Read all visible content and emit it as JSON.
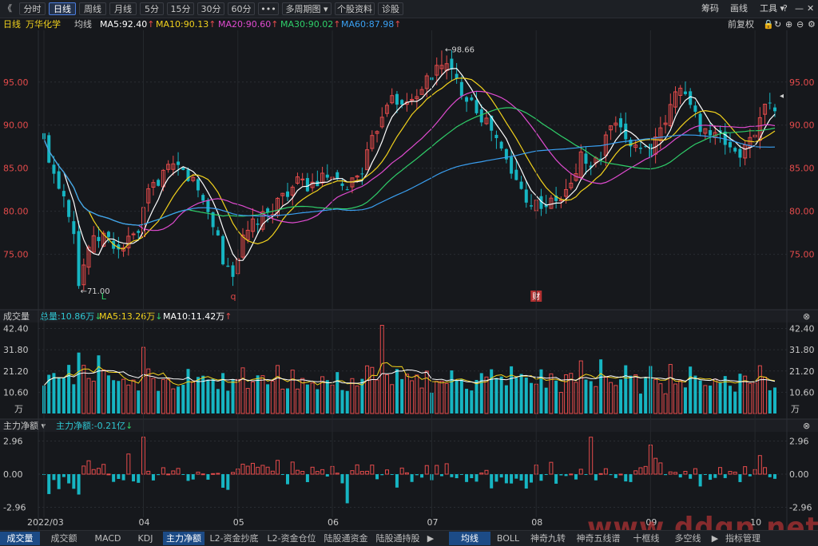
{
  "toolbar": {
    "back_glyph": "《",
    "tabs": [
      "分时",
      "日线",
      "周线",
      "月线",
      "5分",
      "15分",
      "30分",
      "60分",
      "•••",
      "多周期图 ▾",
      "个股资料",
      "诊股"
    ],
    "active_tab": "日线",
    "right": [
      "筹码",
      "画线",
      "工具 ▾"
    ],
    "icons": [
      "help-icon",
      "minimize-icon",
      "close-icon"
    ]
  },
  "header": {
    "period": "日线",
    "stock_name": "万华化学",
    "mode": "均线",
    "ma": [
      {
        "label": "MA5:92.40",
        "arrow": "↑",
        "color": "#ffffff"
      },
      {
        "label": "MA10:90.13",
        "arrow": "↑",
        "color": "#f2d21c"
      },
      {
        "label": "MA20:90.60",
        "arrow": "↑",
        "color": "#e04bd0"
      },
      {
        "label": "MA30:90.02",
        "arrow": "↑",
        "color": "#2fcf6a"
      },
      {
        "label": "MA60:87.98",
        "arrow": "↑",
        "color": "#3aa0f2"
      }
    ],
    "adjust": "前复权",
    "icons": [
      "lock-icon",
      "refresh-icon",
      "zoom-in-icon",
      "zoom-out-icon",
      "settings-icon"
    ]
  },
  "volume_panel": {
    "title": "成交量",
    "total": "总量:10.86万",
    "total_arrow": "↓",
    "ma5": "MA5:13.26万",
    "ma5_arrow": "↓",
    "ma10": "MA10:11.42万",
    "ma10_arrow": "↑"
  },
  "flow_panel": {
    "title": "主力净额 ▾",
    "value": "主力净额:-0.21亿",
    "value_arrow": "↓"
  },
  "bottom_tabs": [
    "成交量",
    "成交额",
    "MACD",
    "KDJ",
    "主力净额",
    "L2-资金抄底",
    "L2-资金仓位",
    "陆股通资金",
    "陆股通持股",
    "▶",
    "均线",
    "BOLL",
    "神奇九转",
    "神奇五线谱",
    "十框线",
    "多空线",
    "▶",
    "指标管理"
  ],
  "bottom_active": [
    "成交量",
    "主力净额",
    "均线"
  ],
  "watermark": "www.ddgp.net",
  "chart_data": {
    "type": "candlestick",
    "price_axis": {
      "ticks": [
        75,
        80,
        85,
        90,
        95
      ],
      "labels": [
        "75.00",
        "80.00",
        "85.00",
        "90.00",
        "95.00"
      ]
    },
    "volume_axis": {
      "ticks": [
        10.6,
        21.2,
        31.8,
        42.4
      ],
      "labels": [
        "10.60",
        "21.20",
        "31.80",
        "42.40"
      ],
      "unit": "万"
    },
    "flow_axis": {
      "ticks": [
        -2.96,
        0,
        2.96
      ],
      "labels": [
        "-2.96",
        "0.00",
        "2.96"
      ]
    },
    "x_labels": [
      {
        "label": "2022/03",
        "index": 0
      },
      {
        "label": "04",
        "index": 20
      },
      {
        "label": "05",
        "index": 39
      },
      {
        "label": "06",
        "index": 58
      },
      {
        "label": "07",
        "index": 78
      },
      {
        "label": "08",
        "index": 99
      },
      {
        "label": "09",
        "index": 122
      },
      {
        "label": "10",
        "index": 143
      }
    ],
    "annotations": [
      {
        "text": "98.66",
        "index": 80,
        "price": 98.66
      },
      {
        "text": "71.00",
        "index": 7,
        "price": 71.0
      }
    ],
    "event_markers": [
      {
        "text": "L",
        "index": 12,
        "color": "#2fcf6a"
      },
      {
        "text": "q",
        "index": 38,
        "color": "#e04848"
      },
      {
        "text": "财",
        "index": 99,
        "color": "#e04848"
      }
    ],
    "key_points": [
      [
        0,
        88.0
      ],
      [
        2,
        84.5
      ],
      [
        4,
        82.0
      ],
      [
        6,
        78.0
      ],
      [
        7,
        71.5
      ],
      [
        9,
        76.0
      ],
      [
        12,
        77.2
      ],
      [
        15,
        75.5
      ],
      [
        17,
        76.5
      ],
      [
        19,
        77.5
      ],
      [
        21,
        82.0
      ],
      [
        24,
        84.5
      ],
      [
        27,
        85.0
      ],
      [
        30,
        83.5
      ],
      [
        33,
        80.0
      ],
      [
        35,
        77.0
      ],
      [
        36,
        74.0
      ],
      [
        38,
        73.0
      ],
      [
        40,
        76.5
      ],
      [
        42,
        78.5
      ],
      [
        45,
        79.5
      ],
      [
        48,
        82.0
      ],
      [
        51,
        83.2
      ],
      [
        54,
        83.0
      ],
      [
        57,
        84.0
      ],
      [
        60,
        82.5
      ],
      [
        62,
        83.5
      ],
      [
        64,
        85.0
      ],
      [
        66,
        88.0
      ],
      [
        68,
        91.5
      ],
      [
        70,
        94.0
      ],
      [
        72,
        92.0
      ],
      [
        74,
        93.0
      ],
      [
        76,
        94.5
      ],
      [
        78,
        95.5
      ],
      [
        80,
        97.5
      ],
      [
        82,
        96.0
      ],
      [
        84,
        94.0
      ],
      [
        86,
        93.0
      ],
      [
        88,
        91.0
      ],
      [
        90,
        89.5
      ],
      [
        92,
        87.0
      ],
      [
        94,
        84.5
      ],
      [
        96,
        82.5
      ],
      [
        98,
        81.0
      ],
      [
        100,
        80.8
      ],
      [
        102,
        80.9
      ],
      [
        104,
        81.5
      ],
      [
        106,
        83.0
      ],
      [
        108,
        86.5
      ],
      [
        110,
        85.0
      ],
      [
        112,
        86.5
      ],
      [
        114,
        90.0
      ],
      [
        116,
        89.0
      ],
      [
        118,
        88.0
      ],
      [
        120,
        87.5
      ],
      [
        122,
        87.0
      ],
      [
        124,
        89.0
      ],
      [
        126,
        92.0
      ],
      [
        128,
        95.0
      ],
      [
        130,
        92.0
      ],
      [
        132,
        90.0
      ],
      [
        134,
        89.0
      ],
      [
        136,
        88.5
      ],
      [
        138,
        87.5
      ],
      [
        140,
        86.5
      ],
      [
        142,
        88.0
      ],
      [
        144,
        91.0
      ],
      [
        146,
        93.0
      ],
      [
        147,
        92.4
      ]
    ],
    "n_candles": 148,
    "ma_series": [
      "MA5",
      "MA10",
      "MA20",
      "MA30",
      "MA60"
    ]
  }
}
